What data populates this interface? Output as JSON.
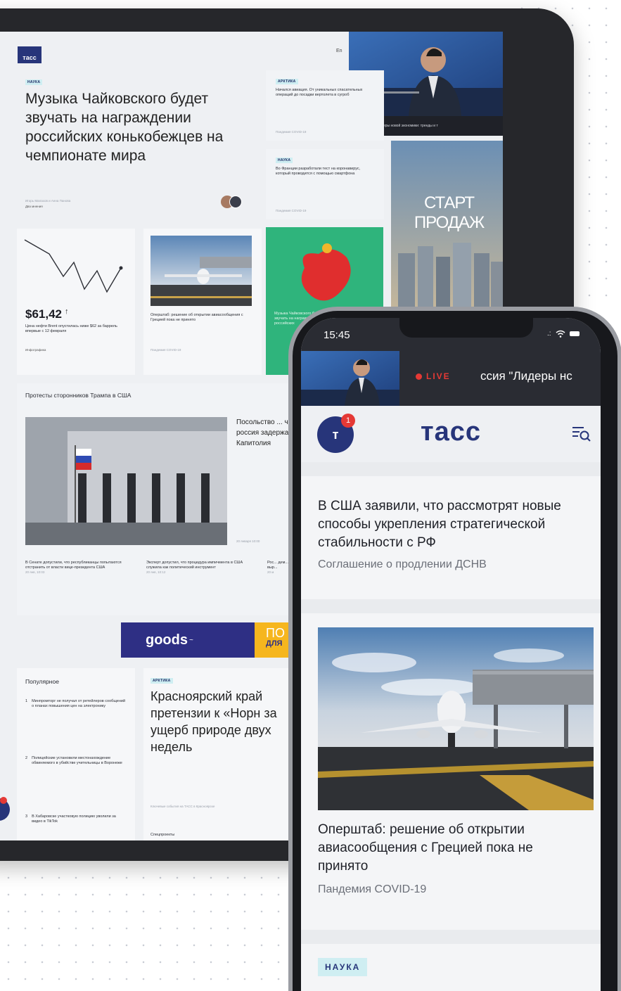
{
  "colors": {
    "brand": "#27357a",
    "live_red": "#e53935",
    "accent_green": "#2fb47c",
    "goods_bg": "#2e2f84",
    "goods_accent": "#f6b61e",
    "tag_bg": "#cfeef2"
  },
  "tablet": {
    "logo": "тасс",
    "header_icons": [
      "language-icon",
      "search-icon",
      "menu-icon"
    ],
    "header_lang": "En",
    "video_caption": "Лидеры новой экономики: тренды и т",
    "main_story": {
      "tag": "НАУКА",
      "title": "Музыка Чайковского будет звучать на награждении российских конькобежцев на чемпионате мира",
      "authors": "Игорь Малахов и Анна Панова",
      "meta": "Два мнения"
    },
    "side_story_1": {
      "tag": "АРКТИКА",
      "text": "Начался авиация. От уникальных спасательных операций до посадки вертолета в сугроб",
      "footer": "Пандемия COVID-19"
    },
    "side_story_2": {
      "tag": "НАУКА",
      "text": "Во Франции разработали тест на коронавирус, который проводится с помощью смартфона",
      "footer": "Пандемия COVID-19"
    },
    "ad_text": "СТАРТ ПРОДАЖ",
    "ticker": {
      "value": "$61,42",
      "arrow": "↑",
      "text": "Цена нефти Brent опустилась ниже $62 за баррель впервые с 12 февраля",
      "footer": "Инфографика"
    },
    "plane_story": {
      "text": "Оперштаб: решение об открытии авиасообщения с Грецией пока не принято",
      "footer": "Пандемия COVID-19"
    },
    "green_story": {
      "text": "Музыка Чайковского будет звучать на награждении российских"
    },
    "section_title": "Протесты сторонников Трампа в США",
    "section_lead": "Посольство ... что россия задержан... Капитолия",
    "section_date": "20 января 10:00",
    "sub_stories": [
      {
        "text": "В Сенате допустили, что республиканцы попытаются отстранить от власти вице-президента США",
        "date": "20 янв, 10:03"
      },
      {
        "text": "Эксперт допустил, что процедура импичмента в США служила как политический инструмент",
        "date": "20 янв, 10:12"
      },
      {
        "text": "Рос... дем... выр...",
        "date": "20 м"
      }
    ],
    "goods_label": "goods",
    "goods_right_1": "ПО",
    "goods_right_2": "ДЛЯ",
    "popular": {
      "title": "Популярное",
      "items": [
        {
          "n": "1",
          "text": "Минпромторг не получал от ретейлеров сообщений о планах повышения цен на электронику"
        },
        {
          "n": "2",
          "text": "Полицейские установили местонахождение обвиняемого в убийстве учительницы в Воронеже"
        },
        {
          "n": "3",
          "text": "В Хабаровске участковую полицию уволили за видео в TikTok"
        }
      ]
    },
    "bottom_story": {
      "tag": "АРКТИКА",
      "title": "Красноярский край претензии к «Норн за ущерб природе двух недель",
      "footer": "Ключевые события на ТАСС в Красноярске",
      "more": "Спецпроекты"
    }
  },
  "phone": {
    "time": "15:45",
    "live_label": "LIVE",
    "live_text": "ссия \"Лидеры нс",
    "logo": "тасс",
    "badge_letter": "т",
    "badge_count": "1",
    "story_1": {
      "title": "В США заявили, что рассмотрят новые способы укрепления стратегической стабильности с РФ",
      "subtitle": "Соглашение о продлении ДСНВ"
    },
    "story_2": {
      "title": "Оперштаб: решение об открытии авиасообщения с Грецией пока не принято",
      "subtitle": "Пандемия COVID-19"
    },
    "next_tag": "НАУКА"
  }
}
